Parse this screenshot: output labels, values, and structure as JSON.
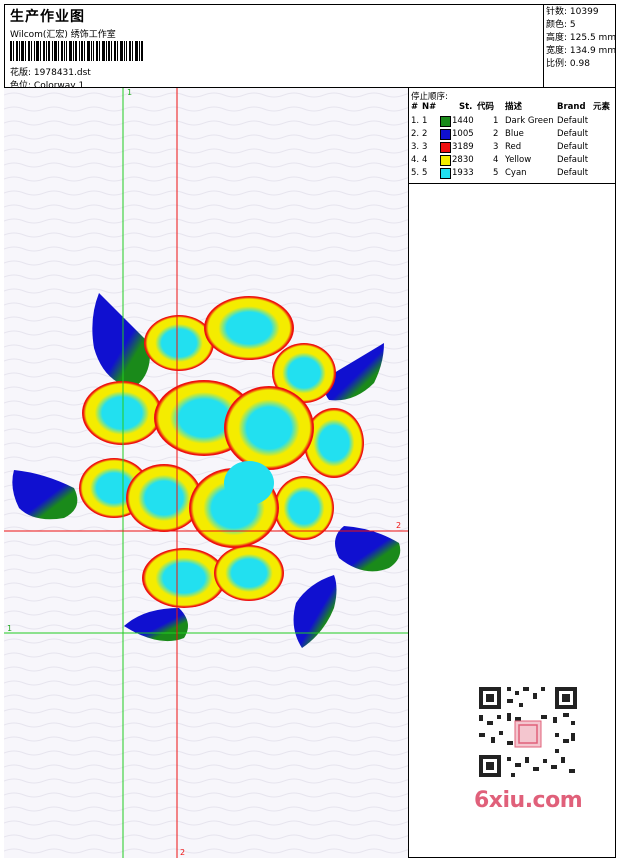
{
  "header": {
    "title": "生产作业图",
    "studio": "Wilcom(汇宏) 绣饰工作室",
    "design_label": "花版:",
    "design_value": "1978431.dst",
    "colorway_label": "色位:",
    "colorway_value": "Colorway 1"
  },
  "stats": {
    "stitches_label": "针数:",
    "stitches_value": "10399",
    "colors_label": "颜色:",
    "colors_value": "5",
    "height_label": "高度:",
    "height_value": "125.5 mm",
    "width_label": "宽度:",
    "width_value": "134.9 mm",
    "scale_label": "比例:",
    "scale_value": "0.98"
  },
  "stop_sequence": {
    "title": "停止顺序:",
    "columns": [
      "#",
      "N#",
      "St.",
      "代码",
      "描述",
      "Brand",
      "元素"
    ],
    "rows": [
      {
        "idx": "1.",
        "n": "1",
        "color": "#1a8a1a",
        "st": "1440",
        "code": "1",
        "desc": "Dark Green",
        "brand": "Default"
      },
      {
        "idx": "2.",
        "n": "2",
        "color": "#1010d0",
        "st": "1005",
        "code": "2",
        "desc": "Blue",
        "brand": "Default"
      },
      {
        "idx": "3.",
        "n": "3",
        "color": "#ee1010",
        "st": "3189",
        "code": "3",
        "desc": "Red",
        "brand": "Default"
      },
      {
        "idx": "4.",
        "n": "4",
        "color": "#f4ec00",
        "st": "2830",
        "code": "4",
        "desc": "Yellow",
        "brand": "Default"
      },
      {
        "idx": "5.",
        "n": "5",
        "color": "#22e0f0",
        "st": "1933",
        "code": "5",
        "desc": "Cyan",
        "brand": "Default"
      }
    ]
  },
  "canvas_markers": {
    "green_top": "1",
    "green_left": "1",
    "red_right": "2",
    "red_bottom": "2"
  },
  "watermark": "6xiu.com",
  "colors": {
    "dark_green": "#1a8a1a",
    "blue": "#1010d0",
    "red": "#ee1010",
    "yellow": "#f4ec00",
    "cyan": "#22e0f0"
  }
}
